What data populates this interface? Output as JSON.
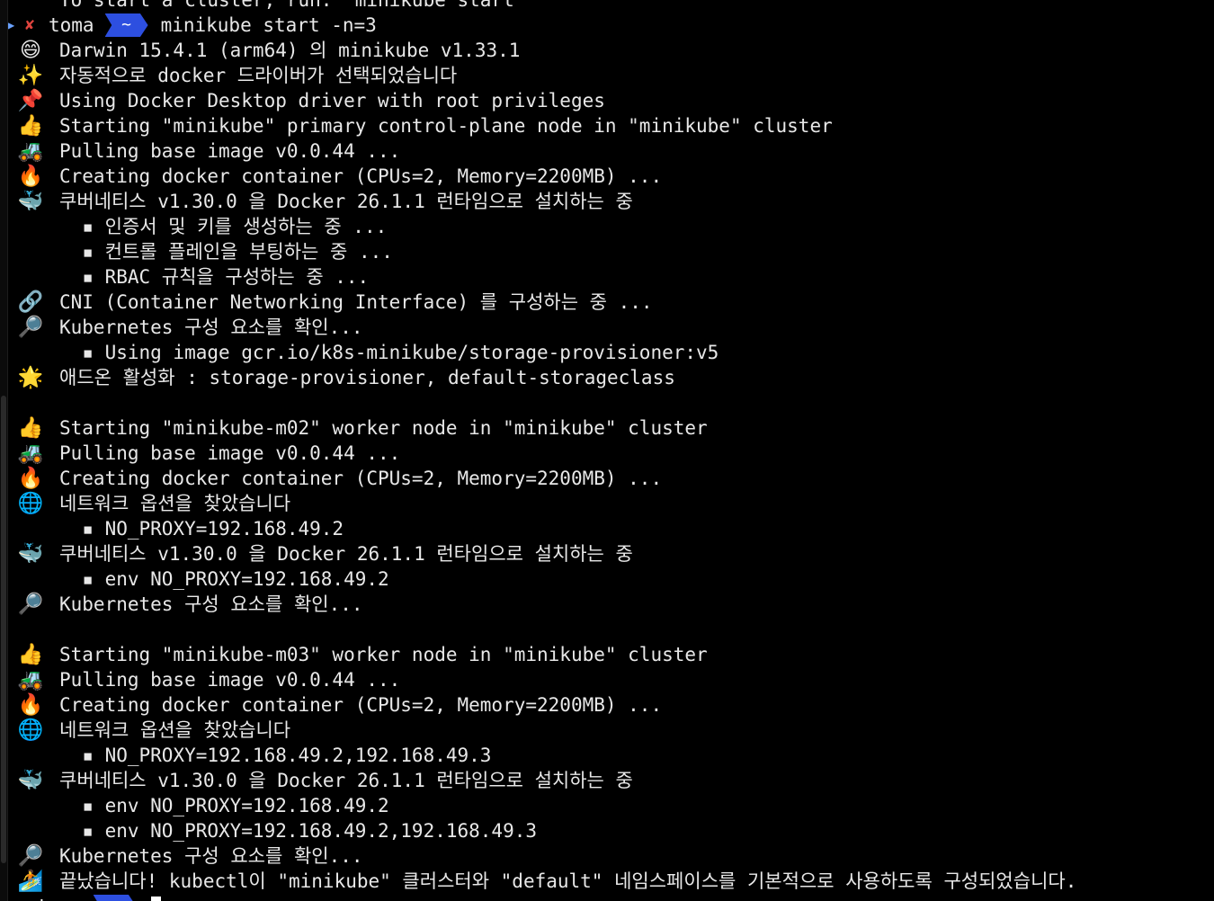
{
  "scrolled_line": "To start a cluster, run: \"minikube start\"",
  "prompt": {
    "user": "toma",
    "dir": "~",
    "command": "minikube start -n=3"
  },
  "bottom_prompt": {
    "user": "toma",
    "dir": "~"
  },
  "lines": [
    {
      "icon": "😄",
      "icon_name": "grinning-face-icon",
      "text": "Darwin 15.4.1 (arm64) 의 minikube v1.33.1"
    },
    {
      "icon": "✨",
      "icon_name": "sparkles-icon",
      "text": "자동적으로 docker 드라이버가 선택되었습니다"
    },
    {
      "icon": "📌",
      "icon_name": "pushpin-icon",
      "text": "Using Docker Desktop driver with root privileges"
    },
    {
      "icon": "👍",
      "icon_name": "thumbs-up-icon",
      "text": "Starting \"minikube\" primary control-plane node in \"minikube\" cluster"
    },
    {
      "icon": "🚜",
      "icon_name": "tractor-icon",
      "text": "Pulling base image v0.0.44 ..."
    },
    {
      "icon": "🔥",
      "icon_name": "fire-icon",
      "text": "Creating docker container (CPUs=2, Memory=2200MB) ..."
    },
    {
      "icon": "🐳",
      "icon_name": "whale-icon",
      "text": "쿠버네티스 v1.30.0 을 Docker 26.1.1 런타임으로 설치하는 중"
    },
    {
      "icon": "",
      "icon_name": "",
      "text": "  ▪ 인증서 및 키를 생성하는 중 ..."
    },
    {
      "icon": "",
      "icon_name": "",
      "text": "  ▪ 컨트롤 플레인을 부팅하는 중 ..."
    },
    {
      "icon": "",
      "icon_name": "",
      "text": "  ▪ RBAC 규칙을 구성하는 중 ..."
    },
    {
      "icon": "🔗",
      "icon_name": "link-icon",
      "text": "CNI (Container Networking Interface) 를 구성하는 중 ..."
    },
    {
      "icon": "🔎",
      "icon_name": "magnifier-icon",
      "text": "Kubernetes 구성 요소를 확인..."
    },
    {
      "icon": "",
      "icon_name": "",
      "text": "  ▪ Using image gcr.io/k8s-minikube/storage-provisioner:v5"
    },
    {
      "icon": "🌟",
      "icon_name": "star-icon",
      "text": "애드온 활성화 : storage-provisioner, default-storageclass"
    },
    {
      "icon": "",
      "icon_name": "",
      "text": ""
    },
    {
      "icon": "👍",
      "icon_name": "thumbs-up-icon",
      "text": "Starting \"minikube-m02\" worker node in \"minikube\" cluster"
    },
    {
      "icon": "🚜",
      "icon_name": "tractor-icon",
      "text": "Pulling base image v0.0.44 ..."
    },
    {
      "icon": "🔥",
      "icon_name": "fire-icon",
      "text": "Creating docker container (CPUs=2, Memory=2200MB) ..."
    },
    {
      "icon": "🌐",
      "icon_name": "globe-icon",
      "text": "네트워크 옵션을 찾았습니다"
    },
    {
      "icon": "",
      "icon_name": "",
      "text": "  ▪ NO_PROXY=192.168.49.2"
    },
    {
      "icon": "🐳",
      "icon_name": "whale-icon",
      "text": "쿠버네티스 v1.30.0 을 Docker 26.1.1 런타임으로 설치하는 중"
    },
    {
      "icon": "",
      "icon_name": "",
      "text": "  ▪ env NO_PROXY=192.168.49.2"
    },
    {
      "icon": "🔎",
      "icon_name": "magnifier-icon",
      "text": "Kubernetes 구성 요소를 확인..."
    },
    {
      "icon": "",
      "icon_name": "",
      "text": ""
    },
    {
      "icon": "👍",
      "icon_name": "thumbs-up-icon",
      "text": "Starting \"minikube-m03\" worker node in \"minikube\" cluster"
    },
    {
      "icon": "🚜",
      "icon_name": "tractor-icon",
      "text": "Pulling base image v0.0.44 ..."
    },
    {
      "icon": "🔥",
      "icon_name": "fire-icon",
      "text": "Creating docker container (CPUs=2, Memory=2200MB) ..."
    },
    {
      "icon": "🌐",
      "icon_name": "globe-icon",
      "text": "네트워크 옵션을 찾았습니다"
    },
    {
      "icon": "",
      "icon_name": "",
      "text": "  ▪ NO_PROXY=192.168.49.2,192.168.49.3"
    },
    {
      "icon": "🐳",
      "icon_name": "whale-icon",
      "text": "쿠버네티스 v1.30.0 을 Docker 26.1.1 런타임으로 설치하는 중"
    },
    {
      "icon": "",
      "icon_name": "",
      "text": "  ▪ env NO_PROXY=192.168.49.2"
    },
    {
      "icon": "",
      "icon_name": "",
      "text": "  ▪ env NO_PROXY=192.168.49.2,192.168.49.3"
    },
    {
      "icon": "🔎",
      "icon_name": "magnifier-icon",
      "text": "Kubernetes 구성 요소를 확인..."
    },
    {
      "icon": "🏄",
      "icon_name": "surfer-icon",
      "text": "끝났습니다! kubectl이 \"minikube\" 클러스터와 \"default\" 네임스페이스를 기본적으로 사용하도록 구성되었습니다."
    }
  ]
}
